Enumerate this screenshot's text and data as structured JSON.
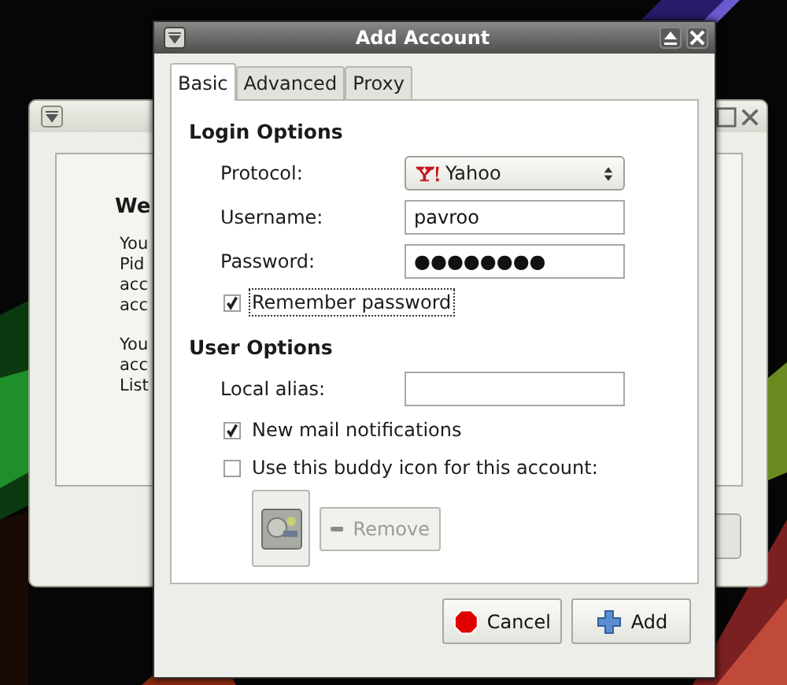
{
  "background_window": {
    "heading": "We",
    "paragraphs": [
      [
        "You",
        "Pid",
        "acc",
        "acc"
      ],
      [
        "You",
        "acc",
        "List"
      ]
    ]
  },
  "dialog": {
    "title": "Add Account",
    "tabs": [
      {
        "label": "Basic",
        "selected": true
      },
      {
        "label": "Advanced",
        "selected": false
      },
      {
        "label": "Proxy",
        "selected": false
      }
    ],
    "sections": [
      {
        "heading": "Login Options",
        "rows": [
          {
            "kind": "dropdown",
            "label": "Protocol:",
            "value": "Yahoo"
          },
          {
            "kind": "text",
            "label": "Username:",
            "value": "pavroo"
          },
          {
            "kind": "text",
            "label": "Password:",
            "value": "●●●●●●●●"
          },
          {
            "kind": "checkbox",
            "label": "Remember password",
            "checked": true,
            "focused": true
          }
        ]
      },
      {
        "heading": "User Options",
        "rows": [
          {
            "kind": "text",
            "label": "Local alias:"
          },
          {
            "kind": "checkbox",
            "label": "New mail notifications",
            "checked": true,
            "focused": false
          },
          {
            "kind": "checkbox",
            "label": "Use this buddy icon for this account:",
            "checked": false,
            "focused": false
          },
          {
            "kind": "icon_chooser",
            "remove": {
              "label": "Remove",
              "disabled": true
            }
          }
        ]
      }
    ],
    "buttons": [
      {
        "kind": "cancel",
        "label": "Cancel"
      },
      {
        "kind": "add",
        "label": "Add"
      }
    ]
  }
}
